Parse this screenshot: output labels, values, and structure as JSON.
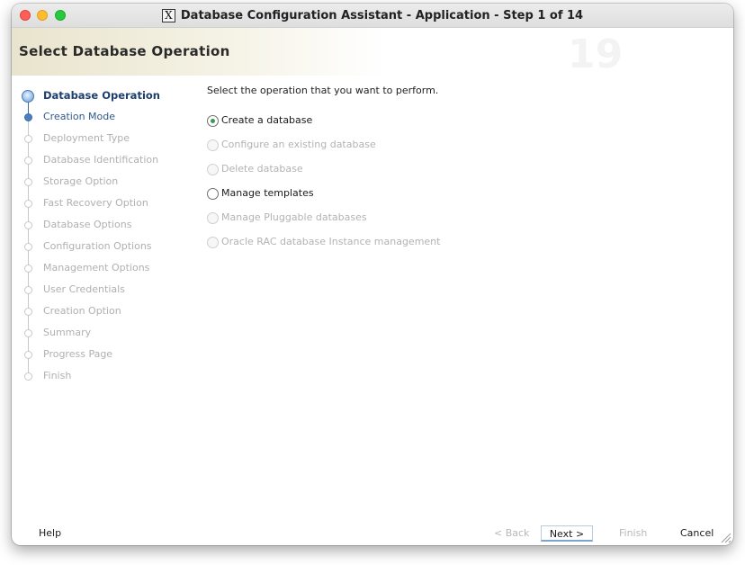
{
  "window": {
    "title": "Database Configuration Assistant - Application - Step 1 of 14",
    "app_icon": "x11-icon"
  },
  "header": {
    "title": "Select Database Operation",
    "watermark": "19"
  },
  "nav": {
    "items": [
      {
        "label": "Database Operation",
        "state": "current"
      },
      {
        "label": "Creation Mode",
        "state": "next"
      },
      {
        "label": "Deployment Type",
        "state": "disabled"
      },
      {
        "label": "Database Identification",
        "state": "disabled"
      },
      {
        "label": "Storage Option",
        "state": "disabled"
      },
      {
        "label": "Fast Recovery Option",
        "state": "disabled"
      },
      {
        "label": "Database Options",
        "state": "disabled"
      },
      {
        "label": "Configuration Options",
        "state": "disabled"
      },
      {
        "label": "Management Options",
        "state": "disabled"
      },
      {
        "label": "User Credentials",
        "state": "disabled"
      },
      {
        "label": "Creation Option",
        "state": "disabled"
      },
      {
        "label": "Summary",
        "state": "disabled"
      },
      {
        "label": "Progress Page",
        "state": "disabled"
      },
      {
        "label": "Finish",
        "state": "disabled"
      }
    ]
  },
  "main": {
    "prompt": "Select the operation that you want to perform.",
    "options": [
      {
        "label": "Create a database",
        "enabled": true,
        "selected": true
      },
      {
        "label": "Configure an existing database",
        "enabled": false,
        "selected": false
      },
      {
        "label": "Delete database",
        "enabled": false,
        "selected": false
      },
      {
        "label": "Manage templates",
        "enabled": true,
        "selected": false
      },
      {
        "label": "Manage Pluggable databases",
        "enabled": false,
        "selected": false
      },
      {
        "label": "Oracle RAC database Instance management",
        "enabled": false,
        "selected": false
      }
    ]
  },
  "footer": {
    "help": "Help",
    "back": "< Back",
    "next": "Next >",
    "finish": "Finish",
    "cancel": "Cancel"
  },
  "colors": {
    "nav_current": "#1d3f6e",
    "nav_next": "#2f5a8e",
    "radio_selected": "#3a9a52",
    "disabled_text": "#b3b3b3"
  }
}
